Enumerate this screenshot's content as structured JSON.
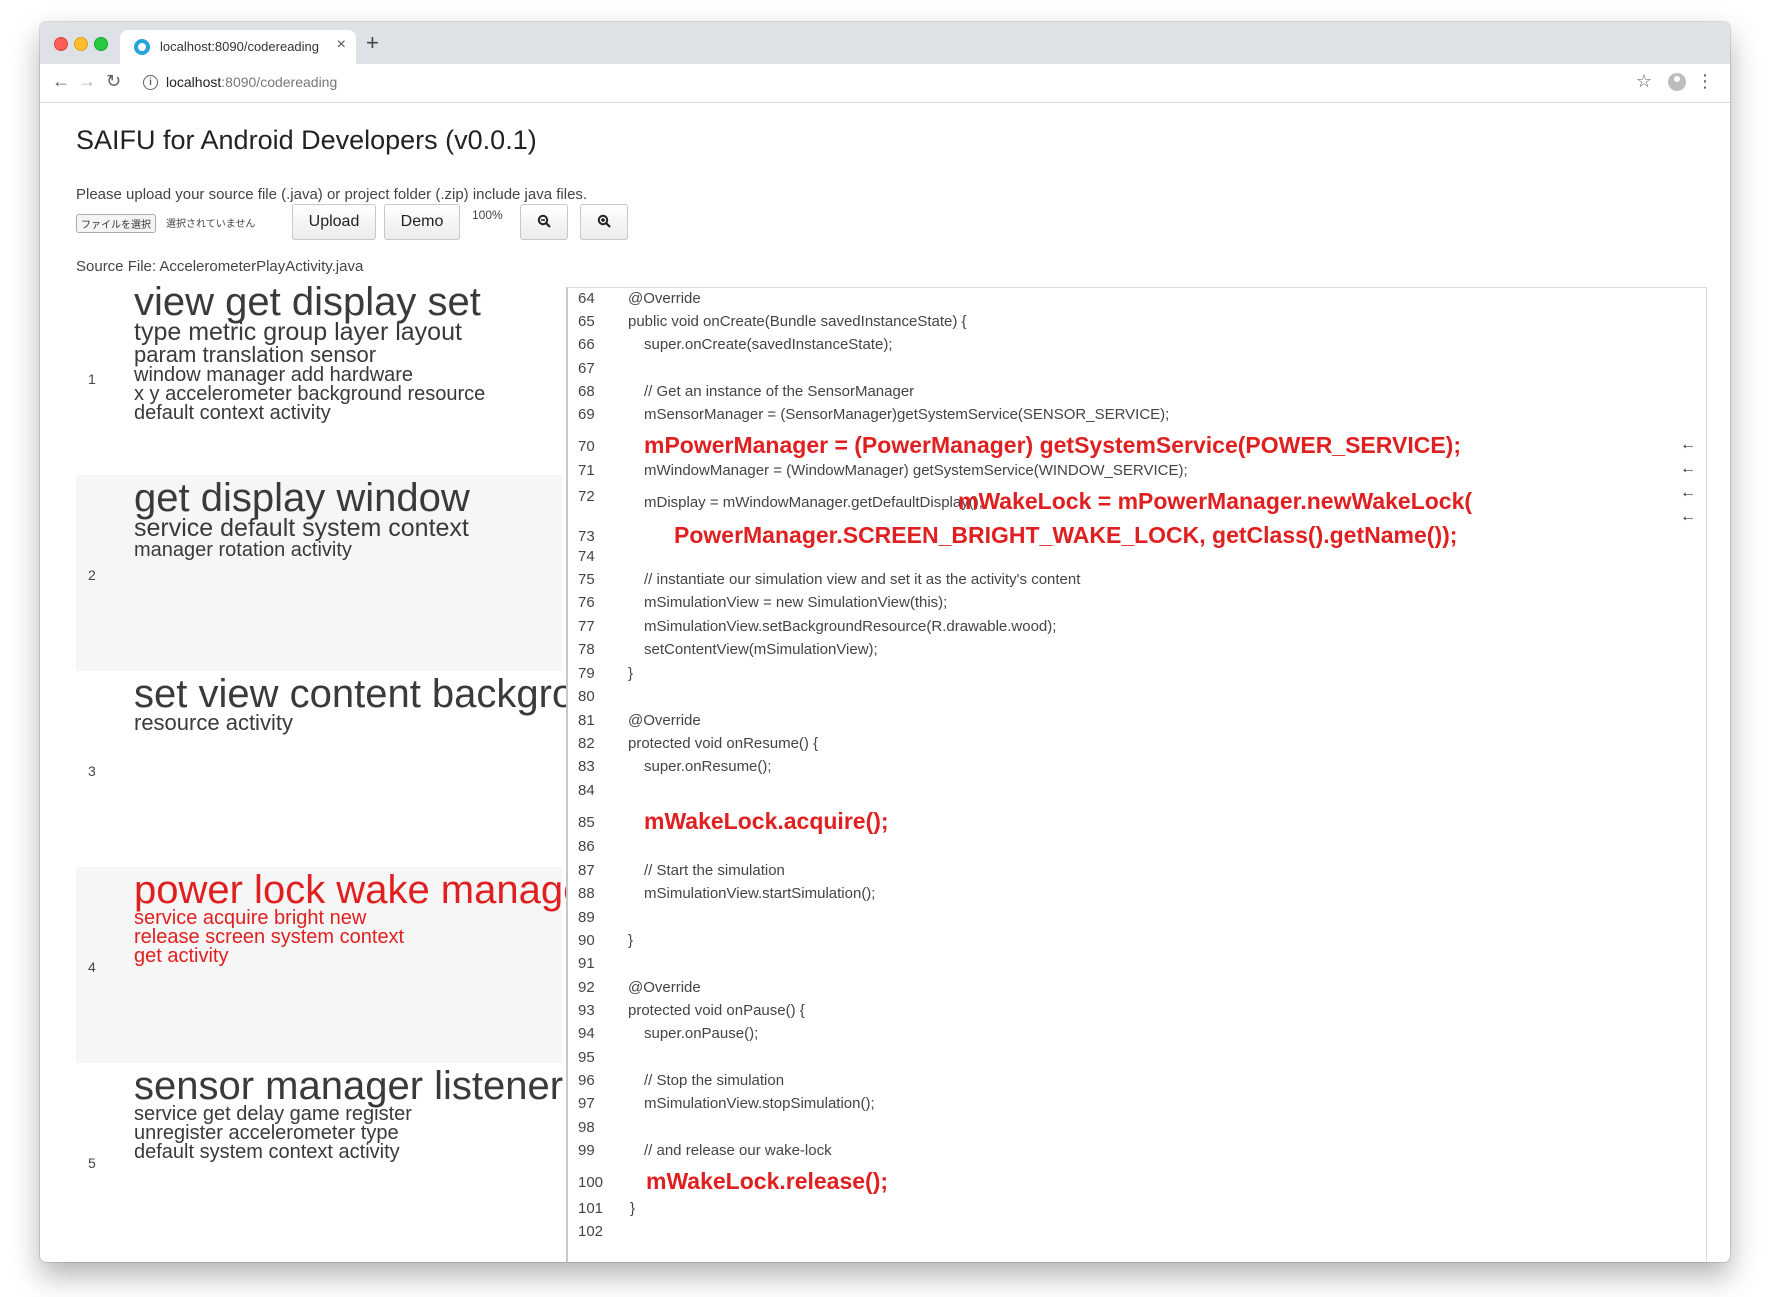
{
  "browser": {
    "tab_title": "localhost:8090/codereading",
    "tab_close": "×",
    "new_tab": "+",
    "url_host": "localhost",
    "url_path": ":8090/codereading"
  },
  "app": {
    "title": "SAIFU for Android Developers (v0.0.1)",
    "instructions": "Please upload your source file (.java) or project folder (.zip) include java files.",
    "file_button": "ファイルを選択",
    "file_status": "選択されていません",
    "upload_label": "Upload",
    "demo_label": "Demo",
    "zoom_level": "100%",
    "source_file": "Source File: AccelerometerPlayActivity.java"
  },
  "topics": [
    {
      "number": "1",
      "rows": [
        "view get display set",
        "type metric group layer layout",
        "param translation sensor",
        "window manager add hardware",
        "x y accelerometer background resource",
        "default context activity"
      ]
    },
    {
      "number": "2",
      "rows": [
        "get display window",
        "service default system context",
        "manager rotation activity"
      ]
    },
    {
      "number": "3",
      "rows": [
        "set view content background",
        "resource activity"
      ]
    },
    {
      "number": "4",
      "rows": [
        "power lock wake manager",
        "service acquire bright new",
        "release screen system context",
        "get activity"
      ]
    },
    {
      "number": "5",
      "rows": [
        "sensor manager listener",
        "service get delay game register",
        "unregister accelerometer type",
        "default system context activity"
      ]
    }
  ],
  "code_lines": [
    {
      "n": "64",
      "t": "@Override"
    },
    {
      "n": "65",
      "t": "public void onCreate(Bundle savedInstanceState) {"
    },
    {
      "n": "66",
      "t": "super.onCreate(savedInstanceState);"
    },
    {
      "n": "67",
      "t": ""
    },
    {
      "n": "68",
      "t": "// Get an instance of the SensorManager"
    },
    {
      "n": "69",
      "t": "mSensorManager = (SensorManager)getSystemService(SENSOR_SERVICE);"
    },
    {
      "n": "70",
      "t": "mPowerManager = (PowerManager) getSystemService(POWER_SERVICE);"
    },
    {
      "n": "71",
      "t": "mWindowManager = (WindowManager) getSystemService(WINDOW_SERVICE);"
    },
    {
      "n": "72",
      "t": "mDisplay = mWindowManager.getDefaultDisplay();",
      "t2": "mWakeLock = mPowerManager.newWakeLock("
    },
    {
      "n": "73",
      "t": "PowerManager.SCREEN_BRIGHT_WAKE_LOCK, getClass().getName());"
    },
    {
      "n": "74",
      "t": ""
    },
    {
      "n": "75",
      "t": "// instantiate our simulation view and set it as the activity's content"
    },
    {
      "n": "76",
      "t": "mSimulationView = new SimulationView(this);"
    },
    {
      "n": "77",
      "t": "mSimulationView.setBackgroundResource(R.drawable.wood);"
    },
    {
      "n": "78",
      "t": "setContentView(mSimulationView);"
    },
    {
      "n": "79",
      "t": "}"
    },
    {
      "n": "80",
      "t": ""
    },
    {
      "n": "81",
      "t": "@Override"
    },
    {
      "n": "82",
      "t": "protected void onResume() {"
    },
    {
      "n": "83",
      "t": "super.onResume();"
    },
    {
      "n": "84",
      "t": ""
    },
    {
      "n": "85",
      "t": "mWakeLock.acquire();"
    },
    {
      "n": "86",
      "t": ""
    },
    {
      "n": "87",
      "t": "// Start the simulation"
    },
    {
      "n": "88",
      "t": "mSimulationView.startSimulation();"
    },
    {
      "n": "89",
      "t": ""
    },
    {
      "n": "90",
      "t": "}"
    },
    {
      "n": "91",
      "t": ""
    },
    {
      "n": "92",
      "t": "@Override"
    },
    {
      "n": "93",
      "t": "protected void onPause() {"
    },
    {
      "n": "94",
      "t": "super.onPause();"
    },
    {
      "n": "95",
      "t": ""
    },
    {
      "n": "96",
      "t": "// Stop the simulation"
    },
    {
      "n": "97",
      "t": "mSimulationView.stopSimulation();"
    },
    {
      "n": "98",
      "t": ""
    },
    {
      "n": "99",
      "t": "// and release our wake-lock"
    },
    {
      "n": "100",
      "t": "mWakeLock.release();"
    },
    {
      "n": "101",
      "t": "}"
    },
    {
      "n": "102",
      "t": ""
    }
  ],
  "arrows": [
    "←",
    "←",
    "←",
    "←"
  ],
  "colors": {
    "highlight": "#e02020",
    "text": "#444444"
  }
}
